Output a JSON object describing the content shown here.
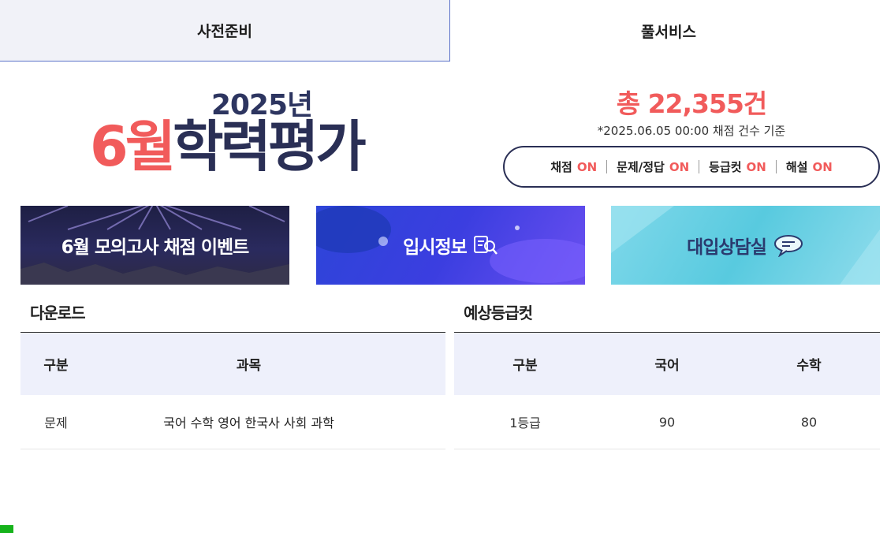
{
  "tabs": {
    "left": "사전준비",
    "right": "풀서비스"
  },
  "hero": {
    "year": "2025년",
    "month": "6월",
    "title": "학력평가"
  },
  "summary": {
    "total": "총 22,355건",
    "note": "*2025.06.05 00:00 채점 건수 기준",
    "status": [
      {
        "label": "채점",
        "value": "ON"
      },
      {
        "label": "문제/정답",
        "value": "ON"
      },
      {
        "label": "등급컷",
        "value": "ON"
      },
      {
        "label": "해설",
        "value": "ON"
      }
    ]
  },
  "banners": [
    {
      "text": "6월 모의고사 채점 이벤트",
      "icon": "none"
    },
    {
      "text": "입시정보",
      "icon": "search-document-icon"
    },
    {
      "text": "대입상담실",
      "icon": "chat-bubble-icon"
    }
  ],
  "download": {
    "title": "다운로드",
    "headers": [
      "구분",
      "과목"
    ],
    "rows": [
      {
        "category": "문제",
        "subjects": "국어 수학 영어 한국사 사회 과학"
      }
    ]
  },
  "gradecut": {
    "title": "예상등급컷",
    "headers": [
      "구분",
      "국어",
      "수학"
    ],
    "rows": [
      {
        "grade": "1등급",
        "korean": "90",
        "math": "80"
      }
    ]
  },
  "colors": {
    "accent": "#f15b5b",
    "navy": "#2a2f55",
    "table_header_bg": "#eef0fb"
  }
}
